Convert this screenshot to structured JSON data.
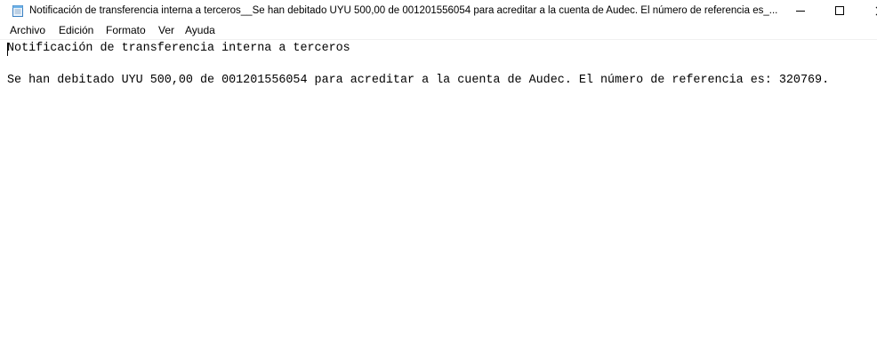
{
  "window": {
    "title": "Notificación de transferencia interna a terceros__Se han debitado UYU 500,00 de 001201556054 para acreditar a la cuenta de Audec. El número de referencia es_...",
    "app_icon": "notepad-icon",
    "controls": [
      "minimize-icon",
      "maximize-icon",
      "close-icon"
    ]
  },
  "menu": {
    "archivo": "Archivo",
    "edicion": "Edición",
    "formato": "Formato",
    "ver": "Ver",
    "ayuda": "Ayuda"
  },
  "document": {
    "line1": "Notificación de transferencia interna a terceros",
    "line2": "Se han debitado UYU 500,00 de 001201556054 para acreditar a la cuenta de Audec. El número de referencia es: 320769."
  }
}
